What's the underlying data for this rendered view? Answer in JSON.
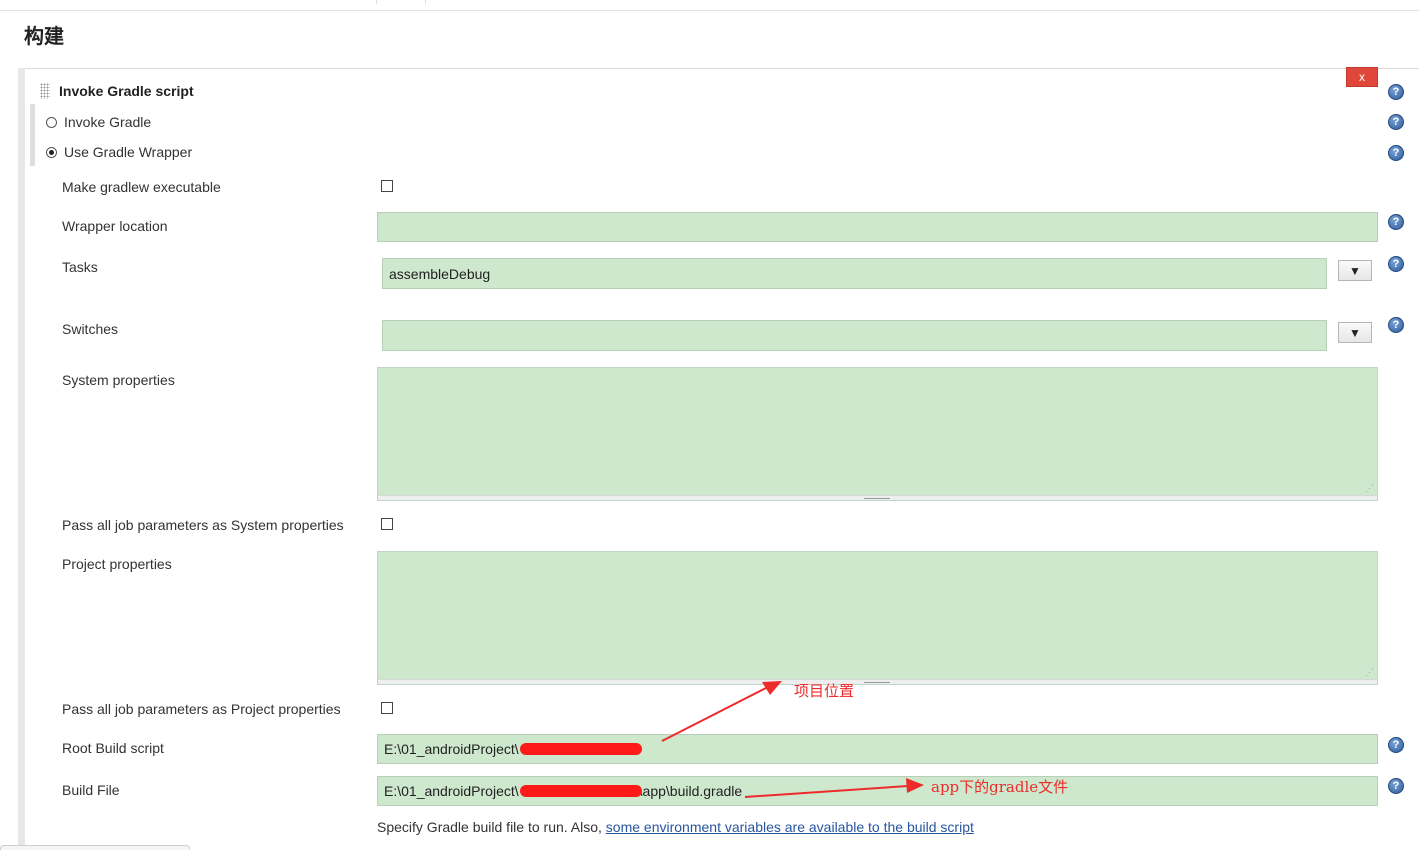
{
  "section": {
    "title": "构建"
  },
  "step": {
    "title": "Invoke Gradle script",
    "delete_label": "x"
  },
  "options": {
    "invoke_gradle": "Invoke Gradle",
    "use_wrapper": "Use Gradle Wrapper"
  },
  "fields": {
    "make_executable_label": "Make gradlew executable",
    "wrapper_location_label": "Wrapper location",
    "wrapper_location_value": "",
    "tasks_label": "Tasks",
    "tasks_value": "assembleDebug",
    "switches_label": "Switches",
    "switches_value": "",
    "system_properties_label": "System properties",
    "pass_system_label": "Pass all job parameters as System properties",
    "project_properties_label": "Project properties",
    "pass_project_label": "Pass all job parameters as Project properties",
    "root_build_label": "Root Build script",
    "root_build_value": "E:\\01_androidProject\\",
    "build_file_label": "Build File",
    "build_file_prefix": "E:\\01_androidProject\\",
    "build_file_suffix": "\\app\\build.gradle"
  },
  "hint": {
    "text": "Specify Gradle build file to run. Also, ",
    "link": "some environment variables are available to the build script"
  },
  "annotations": {
    "project_location": "项目位置",
    "app_gradle": "app下的gradle文件"
  },
  "colors": {
    "field_bg": "#cde8cd",
    "annotation": "#ee2b2b",
    "delete_button": "#e0473a",
    "link": "#2955a0"
  },
  "icons": {
    "help": "help-icon",
    "dropdown": "triangle-down-icon"
  }
}
